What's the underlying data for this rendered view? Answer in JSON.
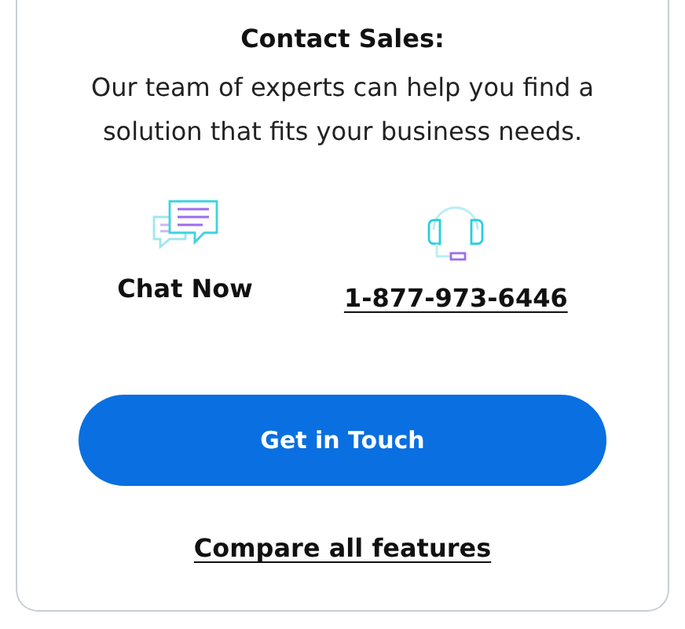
{
  "contact": {
    "title": "Contact Sales:",
    "description": "Our team of experts can help you find a solution that fits your business needs.",
    "options": [
      {
        "kind": "chat",
        "label": "Chat Now"
      },
      {
        "kind": "phone",
        "label": "1-877-973-6446"
      }
    ]
  },
  "primary_button": "Get in Touch",
  "link": "Compare all features"
}
